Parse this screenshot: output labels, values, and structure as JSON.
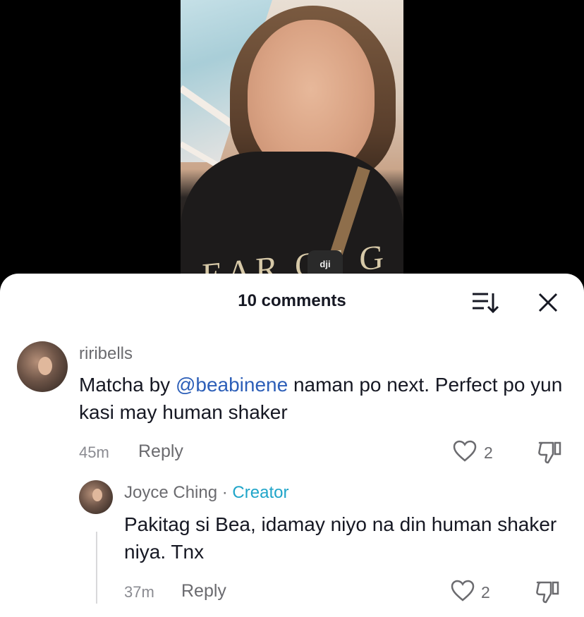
{
  "sheet": {
    "title": "10 comments"
  },
  "video": {
    "shirt_text": "EAR OF G",
    "mic_label": "dji"
  },
  "comments": [
    {
      "username": "riribells",
      "text_before": "Matcha by ",
      "mention": "@beabinene",
      "text_after": " naman po next. Perfect po yun kasi may human shaker",
      "time": "45m",
      "reply_label": "Reply",
      "likes": "2"
    },
    {
      "username": "Joyce Ching",
      "separator": "·",
      "badge": "Creator",
      "text": "Pakitag si Bea, idamay niyo na din human shaker niya. Tnx",
      "time": "37m",
      "reply_label": "Reply",
      "likes": "2"
    }
  ],
  "icons": {
    "sort": "sort-icon",
    "close": "close-icon",
    "like": "heart-icon",
    "dislike": "thumbs-down-icon"
  }
}
